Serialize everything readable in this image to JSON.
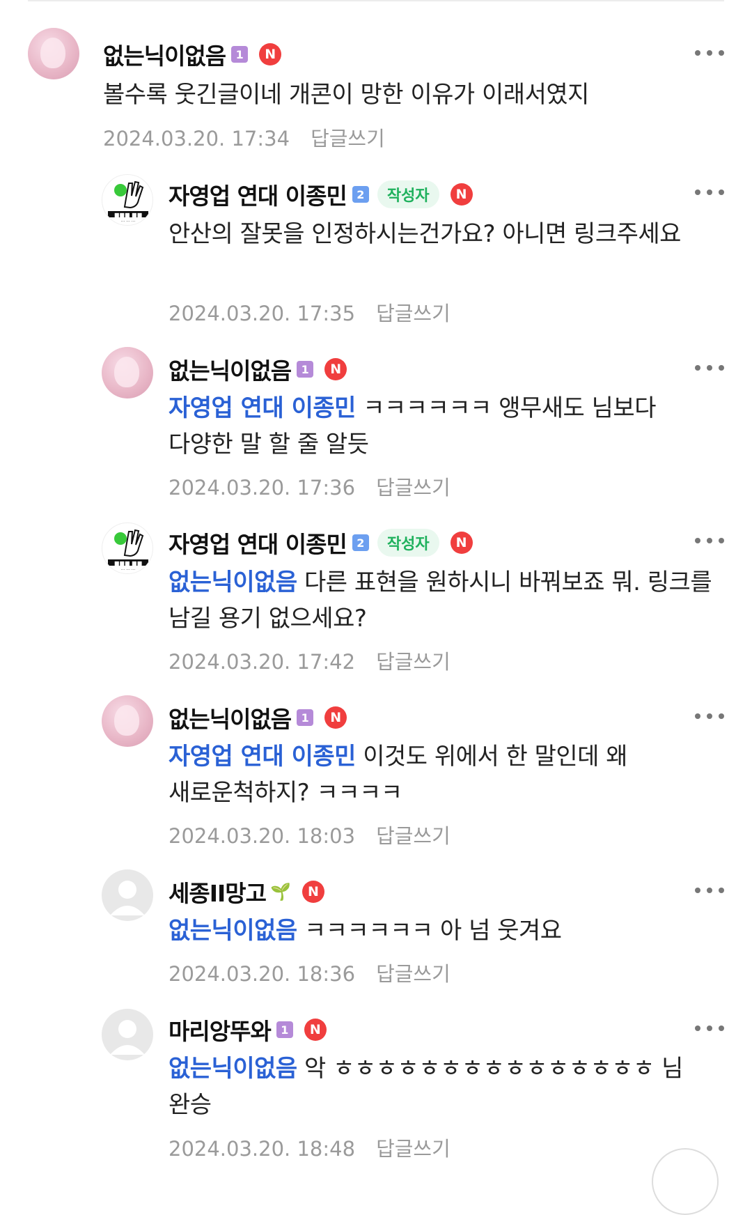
{
  "comments": [
    {
      "nick": "없는닉이없음",
      "level": "1",
      "author_badge": "",
      "sprout": "",
      "mention": "",
      "text": "볼수록 웃긴글이네 개콘이 망한 이유가 이래서였지",
      "date": "2024.03.20. 17:34",
      "reply": "답글쓰기",
      "avatar": "pink-flower"
    },
    {
      "nick": "자영업 연대 이종민",
      "level": "2",
      "author_badge": "작성자",
      "sprout": "",
      "mention": "",
      "text": "안산의 잘못을 인정하시는건가요? 아니면 링크주세요",
      "date": "2024.03.20. 17:35",
      "reply": "답글쓰기",
      "avatar": "green-hand-logo"
    },
    {
      "nick": "없는닉이없음",
      "level": "1",
      "author_badge": "",
      "sprout": "",
      "mention": "자영업 연대 이종민",
      "text": "ㅋㅋㅋㅋㅋㅋ 앵무새도 님보다 다양한 말 할 줄 알듯",
      "date": "2024.03.20. 17:36",
      "reply": "답글쓰기",
      "avatar": "pink-flower"
    },
    {
      "nick": "자영업 연대 이종민",
      "level": "2",
      "author_badge": "작성자",
      "sprout": "",
      "mention": "없는닉이없음",
      "text": "다른 표현을 원하시니 바꿔보죠 뭐. 링크를 남길 용기 없으세요?",
      "date": "2024.03.20. 17:42",
      "reply": "답글쓰기",
      "avatar": "green-hand-logo"
    },
    {
      "nick": "없는닉이없음",
      "level": "1",
      "author_badge": "",
      "sprout": "",
      "mention": "자영업 연대 이종민",
      "text": "이것도 위에서 한 말인데 왜 새로운척하지? ㅋㅋㅋㅋ",
      "date": "2024.03.20. 18:03",
      "reply": "답글쓰기",
      "avatar": "pink-flower"
    },
    {
      "nick": "세종II망고",
      "level": "",
      "author_badge": "",
      "sprout": "sprout-icon",
      "mention": "없는닉이없음",
      "text": "ㅋㅋㅋㅋㅋㅋ 아 넘 웃겨요",
      "date": "2024.03.20. 18:36",
      "reply": "답글쓰기",
      "avatar": "default-gray"
    },
    {
      "nick": "마리앙뚜와",
      "level": "1",
      "author_badge": "",
      "sprout": "",
      "mention": "없는닉이없음",
      "text": "악 ㅎㅎㅎㅎㅎㅎㅎㅎㅎㅎㅎㅎㅎㅎㅎ 님 완승",
      "date": "2024.03.20. 18:48",
      "reply": "답글쓰기",
      "avatar": "default-gray"
    }
  ],
  "n_badge_label": "N",
  "colors": {
    "mention": "#2a61d5",
    "author_badge": "#1fb15d",
    "n_badge": "#f03e3e",
    "level1": "#b58ad8",
    "level2": "#6c9ff0"
  }
}
